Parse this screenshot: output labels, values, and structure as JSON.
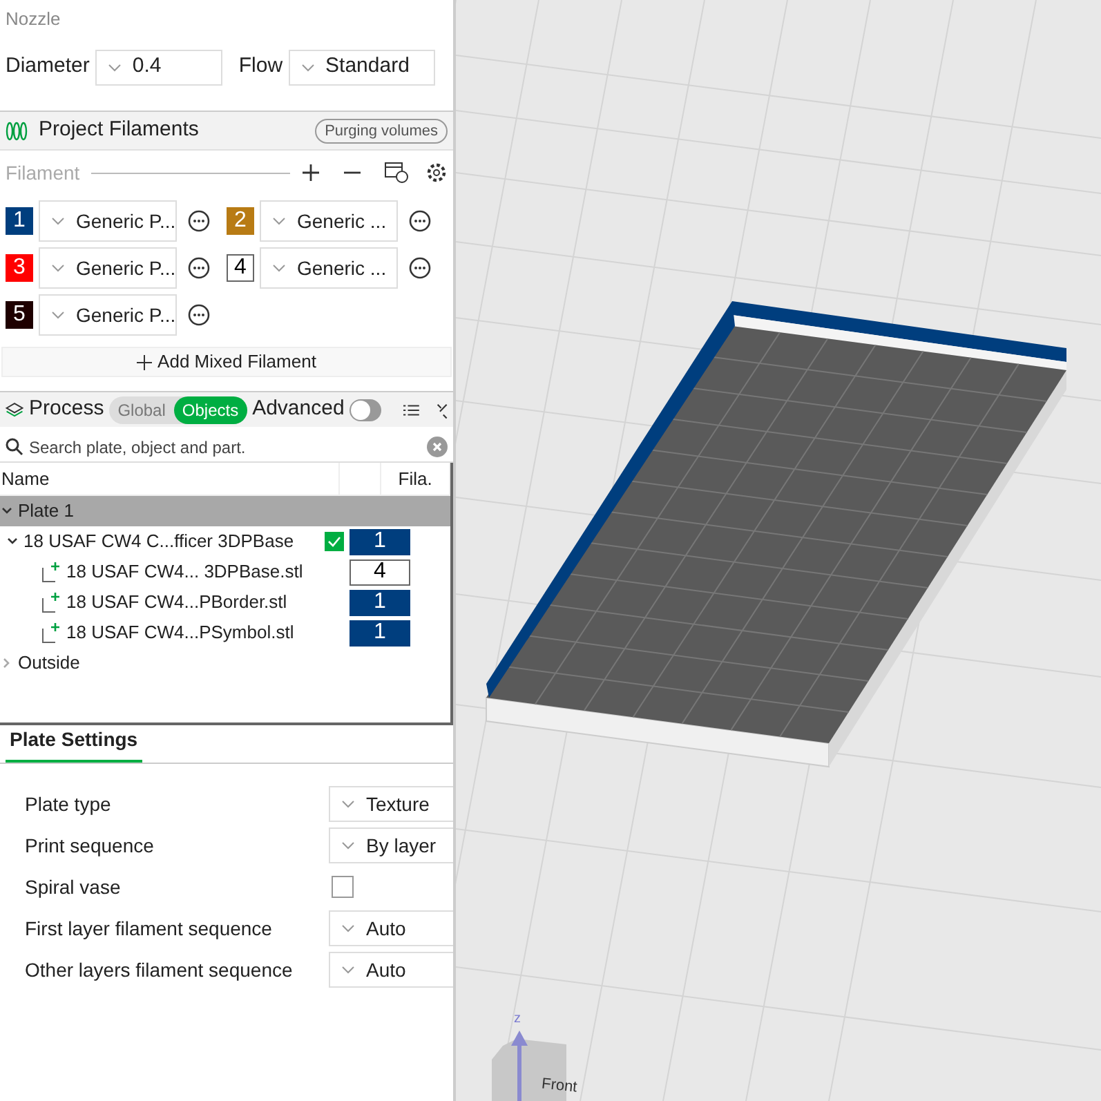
{
  "nozzle": {
    "title": "Nozzle",
    "diameter_label": "Diameter",
    "diameter_value": "0.4",
    "flow_label": "Flow",
    "flow_value": "Standard"
  },
  "filaments": {
    "title": "Project Filaments",
    "purging_button": "Purging volumes",
    "header_label": "Filament",
    "items": [
      {
        "number": "1",
        "color": "#003e7e",
        "preset": "Generic P..."
      },
      {
        "number": "2",
        "color": "#b87b14",
        "preset": "Generic ..."
      },
      {
        "number": "3",
        "color": "#ff0000",
        "preset": "Generic P..."
      },
      {
        "number": "4",
        "color": "#ffffff",
        "preset": "Generic ..."
      },
      {
        "number": "5",
        "color": "#1e0000",
        "preset": "Generic P..."
      }
    ],
    "add_button": "Add Mixed Filament"
  },
  "process": {
    "title": "Process",
    "modes": [
      {
        "label": "Global",
        "selected": false
      },
      {
        "label": "Objects",
        "selected": true
      }
    ],
    "advanced_label": "Advanced",
    "advanced_on": false
  },
  "search": {
    "placeholder": "Search plate, object and part."
  },
  "tree": {
    "columns": [
      "Name",
      "Fila."
    ],
    "plates": [
      {
        "name": "Plate 1",
        "expanded": true,
        "selected": true,
        "children": [
          {
            "name": "18 USAF CW4 C...fficer 3DPBase",
            "expanded": true,
            "checked": true,
            "filament": {
              "number": "1",
              "color": "#003e7e"
            },
            "children": [
              {
                "name": "18 USAF CW4... 3DPBase.stl",
                "filament": {
                  "number": "4",
                  "color": "#ffffff"
                }
              },
              {
                "name": "18 USAF CW4...PBorder.stl",
                "filament": {
                  "number": "1",
                  "color": "#003e7e"
                }
              },
              {
                "name": "18 USAF CW4...PSymbol.stl",
                "filament": {
                  "number": "1",
                  "color": "#003e7e"
                }
              }
            ]
          }
        ]
      },
      {
        "name": "Outside",
        "expanded": false,
        "selected": false
      }
    ]
  },
  "plate_settings": {
    "tab": "Plate Settings",
    "rows": [
      {
        "kind": "select",
        "label": "Plate type",
        "value": "Texture"
      },
      {
        "kind": "select",
        "label": "Print sequence",
        "value": "By layer"
      },
      {
        "kind": "checkbox",
        "label": "Spiral vase",
        "checked": false
      },
      {
        "kind": "select",
        "label": "First layer filament sequence",
        "value": "Auto"
      },
      {
        "kind": "select",
        "label": "Other layers filament sequence",
        "value": "Auto"
      }
    ]
  },
  "viewport": {
    "axis_label": "z",
    "cube_face": "Front"
  }
}
